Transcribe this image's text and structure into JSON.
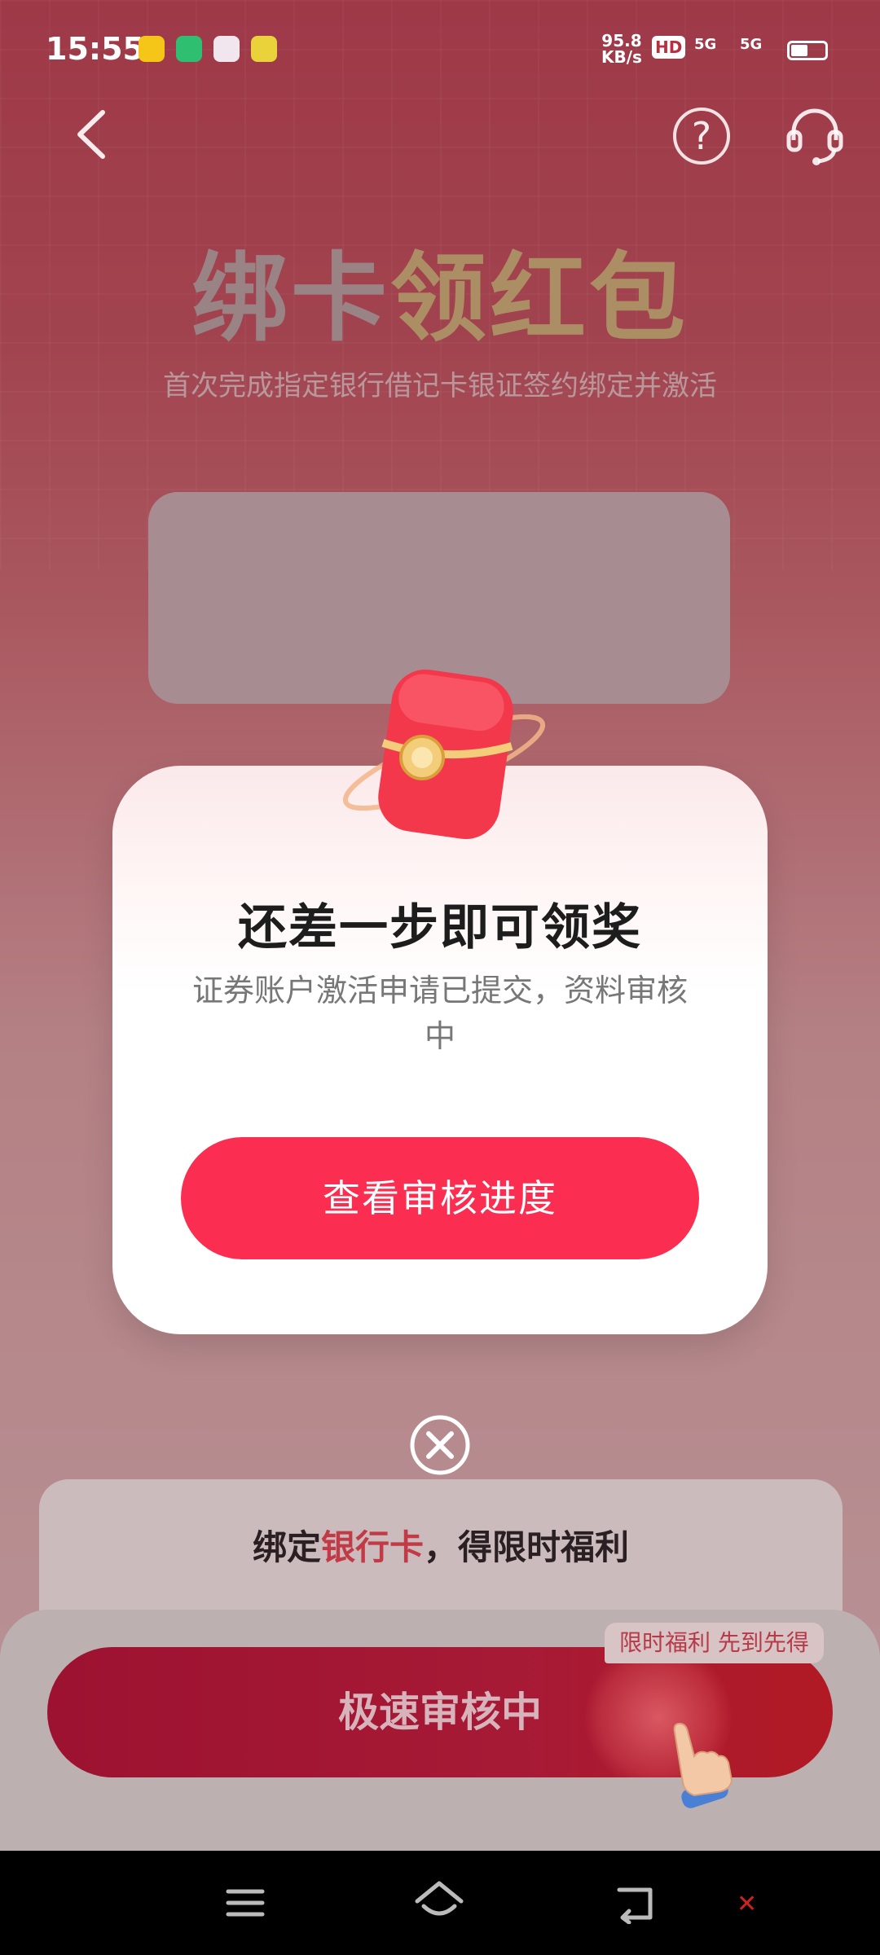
{
  "status_bar": {
    "time": "15:55",
    "net_speed_value": "95.8",
    "net_speed_unit": "KB/s",
    "hd_badge": "HD",
    "signal_1": "5G",
    "signal_2": "5G"
  },
  "header": {
    "hero_title_part1": "绑卡",
    "hero_title_part2": "领红包",
    "hero_subtitle": "首次完成指定银行借记卡银证签约绑定并激活"
  },
  "modal": {
    "title": "还差一步即可领奖",
    "description": "证券账户激活申请已提交，资料审核中",
    "button_label": "查看审核进度"
  },
  "bind_card": {
    "prefix": "绑定",
    "highlight": "银行卡",
    "suffix": "，得限时福利"
  },
  "bottom": {
    "cta_label": "极速审核中",
    "promo_tag": "限时福利 先到先得"
  },
  "colors": {
    "accent": "#fb2d50",
    "cta_dark": "#a71a36",
    "hero_gold": "#d9bb6f"
  },
  "icons": [
    "back-arrow-icon",
    "help-icon",
    "customer-service-icon",
    "red-envelope-icon",
    "close-icon",
    "pointing-hand-icon",
    "menu-icon",
    "home-icon",
    "back-icon"
  ]
}
